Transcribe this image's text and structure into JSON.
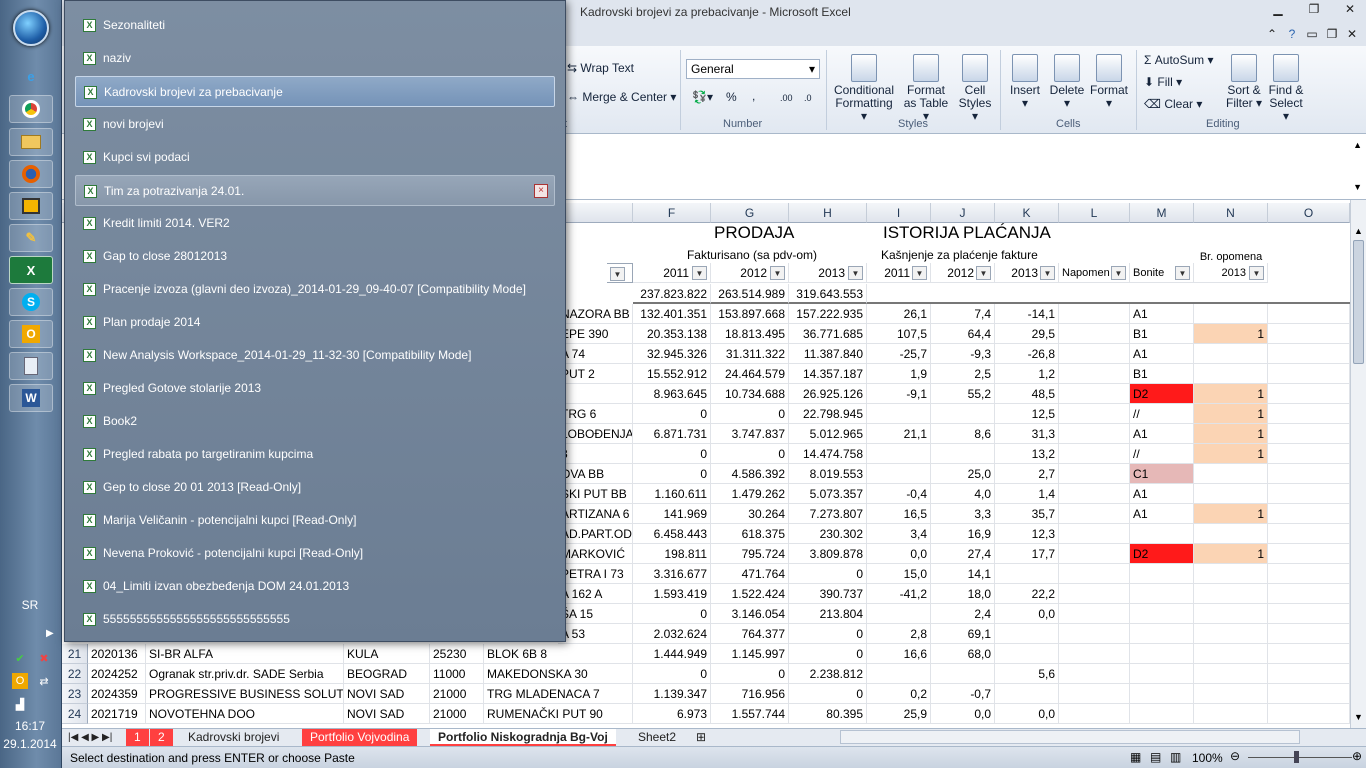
{
  "window": {
    "title": "Kadrovski brojevi za prebacivanje  -  Microsoft Excel"
  },
  "taskbar": {
    "language": "SR",
    "time": "16:17",
    "date": "29.1.2014",
    "buttons": [
      "ie-icon",
      "chrome-icon",
      "explorer-icon",
      "firefox-icon",
      "file-manager-icon",
      "tool-icon",
      "excel-icon",
      "skype-icon",
      "outlook-icon",
      "notepad-icon",
      "word-icon"
    ]
  },
  "ribbon": {
    "wrap_text": "Wrap Text",
    "merge_center": "Merge & Center",
    "number_format": "General",
    "percent": "%",
    "comma": ",",
    "inc_dec": ".00",
    "dec_dec": ".0",
    "conditional": "Conditional",
    "formatting": "Formatting",
    "format_as": "Format",
    "as_table": "as Table",
    "cell": "Cell",
    "styles_lbl": "Styles",
    "insert": "Insert",
    "delete": "Delete",
    "format": "Format",
    "autosum": "AutoSum",
    "fill": "Fill",
    "clear": "Clear",
    "sort": "Sort &",
    "filter": "Filter",
    "find": "Find &",
    "select": "Select",
    "groups": {
      "alignment_tail": "t",
      "number": "Number",
      "styles": "Styles",
      "cells": "Cells",
      "editing": "Editing"
    }
  },
  "columns": [
    "F",
    "G",
    "H",
    "I",
    "J",
    "K",
    "L",
    "M",
    "N",
    "O"
  ],
  "header": {
    "prodaja": "PRODAJA",
    "istorija": "ISTORIJA PLAĆANJA",
    "fakturisano": "Fakturisano (sa pdv-om)",
    "kasnjenje": "Kašnjenje za plaćenje fakture",
    "opomena": "Br. opomena",
    "years": [
      "2011",
      "2012",
      "2013",
      "2011",
      "2012",
      "2013"
    ],
    "napomena": "Napomen",
    "bonitet": "Bonite",
    "n_year": "2013",
    "totals": [
      "237.823.822",
      "263.514.989",
      "319.643.553"
    ]
  },
  "rows": [
    {
      "e": "NAZORA BB",
      "f": "132.401.351",
      "g": "153.897.668",
      "h": "157.222.935",
      "i": "26,1",
      "j": "7,4",
      "k": "-14,1",
      "m": "A1",
      "n": ""
    },
    {
      "e": "EPE 390",
      "f": "20.353.138",
      "g": "18.813.495",
      "h": "36.771.685",
      "i": "107,5",
      "j": "64,4",
      "k": "29,5",
      "m": "B1",
      "n": "1"
    },
    {
      "e": "A 74",
      "f": "32.945.326",
      "g": "31.311.322",
      "h": "11.387.840",
      "i": "-25,7",
      "j": "-9,3",
      "k": "-26,8",
      "m": "A1",
      "n": ""
    },
    {
      "e": "PUT 2",
      "f": "15.552.912",
      "g": "24.464.579",
      "h": "14.357.187",
      "i": "1,9",
      "j": "2,5",
      "k": "1,2",
      "m": "B1",
      "n": ""
    },
    {
      "e": "",
      "f": "8.963.645",
      "g": "10.734.688",
      "h": "26.925.126",
      "i": "-9,1",
      "j": "55,2",
      "k": "48,5",
      "m": "D2",
      "n": "1"
    },
    {
      "e": " TRG 6",
      "f": "0",
      "g": "0",
      "h": "22.798.945",
      "i": "",
      "j": "",
      "k": "12,5",
      "m": "//",
      "n": "1"
    },
    {
      "e": "LOBOĐENJA",
      "f": "6.871.731",
      "g": "3.747.837",
      "h": "5.012.965",
      "i": "21,1",
      "j": "8,6",
      "k": "31,3",
      "m": "A1",
      "n": "1"
    },
    {
      "e": "3",
      "f": "0",
      "g": "0",
      "h": "14.474.758",
      "i": "",
      "j": "",
      "k": "13,2",
      "m": "//",
      "n": "1"
    },
    {
      "e": "OVA BB",
      "f": "0",
      "g": "4.586.392",
      "h": "8.019.553",
      "i": "",
      "j": "25,0",
      "k": "2,7",
      "m": "C1",
      "n": ""
    },
    {
      "e": "SKI PUT BB",
      "f": "1.160.611",
      "g": "1.479.262",
      "h": "5.073.357",
      "i": "-0,4",
      "j": "4,0",
      "k": "1,4",
      "m": "A1",
      "n": ""
    },
    {
      "e": "ARTIZANA 6",
      "f": "141.969",
      "g": "30.264",
      "h": "7.273.807",
      "i": "16,5",
      "j": "3,3",
      "k": "35,7",
      "m": "A1",
      "n": "1"
    },
    {
      "e": "AD.PART.OD",
      "f": "6.458.443",
      "g": "618.375",
      "h": "230.302",
      "i": "3,4",
      "j": "16,9",
      "k": "12,3",
      "m": "",
      "n": ""
    },
    {
      "e": "MARKOVIĆ",
      "f": "198.811",
      "g": "795.724",
      "h": "3.809.878",
      "i": "0,0",
      "j": "27,4",
      "k": "17,7",
      "m": "D2",
      "n": "1"
    },
    {
      "e": "PETRA I 73",
      "f": "3.316.677",
      "g": "471.764",
      "h": "0",
      "i": "15,0",
      "j": "14,1",
      "k": "",
      "m": "",
      "n": ""
    },
    {
      "e": "A 162 A",
      "f": "1.593.419",
      "g": "1.522.424",
      "h": "390.737",
      "i": "-41,2",
      "j": "18,0",
      "k": "22,2",
      "m": "",
      "n": ""
    },
    {
      "e": "ŠA 15",
      "f": "0",
      "g": "3.146.054",
      "h": "213.804",
      "i": "",
      "j": "2,4",
      "k": "0,0",
      "m": "",
      "n": ""
    },
    {
      "e": "A 53",
      "f": "2.032.624",
      "g": "764.377",
      "h": "0",
      "i": "2,8",
      "j": "69,1",
      "k": "",
      "m": "",
      "n": ""
    }
  ],
  "full_rows": [
    {
      "num": "21",
      "a": "2020136",
      "b": "SI-BR ALFA",
      "c": "KULA",
      "d": "25230",
      "e": "BLOK 6B 8",
      "f": "1.444.949",
      "g": "1.145.997",
      "h": "0",
      "i": "16,6",
      "j": "68,0",
      "k": ""
    },
    {
      "num": "22",
      "a": "2024252",
      "b": "Ogranak str.priv.dr. SADE Serbia",
      "c": "BEOGRAD",
      "d": "11000",
      "e": "MAKEDONSKA 30",
      "f": "0",
      "g": "0",
      "h": "2.238.812",
      "i": "",
      "j": "",
      "k": "5,6"
    },
    {
      "num": "23",
      "a": "2024359",
      "b": "PROGRESSIVE BUSINESS SOLUTIO",
      "c": "NOVI SAD",
      "d": "21000",
      "e": "TRG MLADENACA 7",
      "f": "1.139.347",
      "g": "716.956",
      "h": "0",
      "i": "0,2",
      "j": "-0,7",
      "k": ""
    },
    {
      "num": "24",
      "a": "2021719",
      "b": "NOVOTEHNA  DOO",
      "c": "NOVI SAD",
      "d": "21000",
      "e": "RUMENAČKI PUT 90",
      "f": "6.973",
      "g": "1.557.744",
      "h": "80.395",
      "i": "25,9",
      "j": "0,0",
      "k": "0,0"
    }
  ],
  "colors": {
    "red": "#ff1a1a",
    "pink": "#e6b8b7",
    "peach": "#fbd4b4"
  },
  "tabs": [
    "1",
    "2",
    "Kadrovski brojevi",
    "Portfolio Vojvodina",
    "Portfolio Niskogradnja Bg-Voj",
    "Sheet2"
  ],
  "status": {
    "message": "Select destination and press ENTER or choose Paste",
    "zoom": "100%"
  },
  "jumplist": [
    "Sezonaliteti",
    "naziv",
    "Kadrovski brojevi za prebacivanje",
    "novi brojevi",
    "Kupci svi podaci",
    "Tim za potrazivanja 24.01.",
    "Kredit limiti 2014. VER2",
    "Gap to close 28012013",
    "Pracenje izvoza (glavni deo izvoza)_2014-01-29_09-40-07  [Compatibility Mode]",
    "Plan prodaje 2014",
    "New Analysis Workspace_2014-01-29_11-32-30  [Compatibility Mode]",
    "Pregled Gotove stolarije 2013",
    "Book2",
    "Pregled rabata po targetiranim kupcima",
    "Gep to close 20 01 2013  [Read-Only]",
    "Marija Veličanin - potencijalni kupci  [Read-Only]",
    "Nevena Proković - potencijalni kupci  [Read-Only]",
    "04_Limiti izvan obezbeđenja DOM 24.01.2013",
    "5555555555555555555555555555"
  ]
}
